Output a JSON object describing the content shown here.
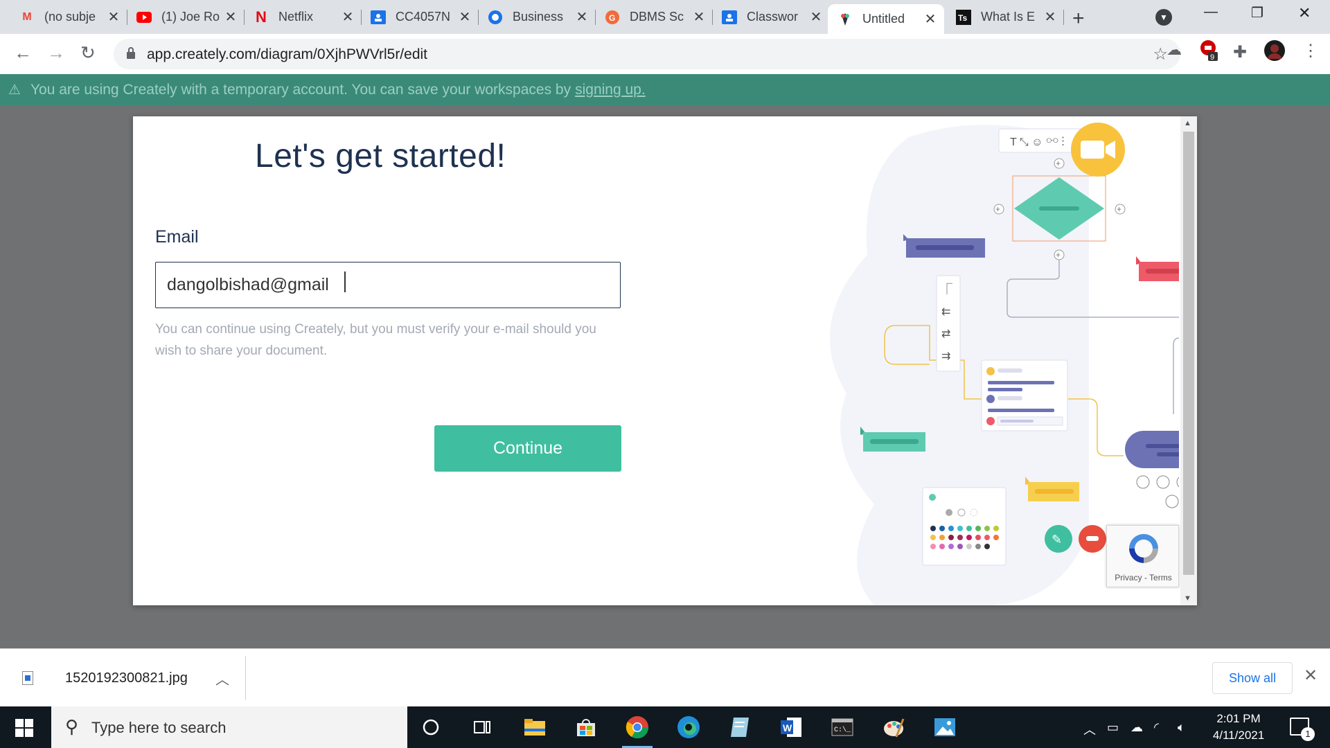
{
  "browser": {
    "tabs": [
      {
        "title": "(no subje",
        "icon": "gmail-icon",
        "active": false
      },
      {
        "title": "(1) Joe Ro",
        "icon": "youtube-icon",
        "active": false
      },
      {
        "title": "Netflix",
        "icon": "netflix-icon",
        "active": false
      },
      {
        "title": "CC4057N",
        "icon": "classroom-icon",
        "active": false
      },
      {
        "title": "Business",
        "icon": "teams-icon",
        "active": false
      },
      {
        "title": "DBMS Sc",
        "icon": "app-icon",
        "active": false
      },
      {
        "title": "Classwor",
        "icon": "classroom-icon",
        "active": false
      },
      {
        "title": "Untitled",
        "icon": "creately-icon",
        "active": true
      },
      {
        "title": "What Is E",
        "icon": "ts-icon",
        "active": false
      }
    ],
    "new_tab_label": "+",
    "url": "app.creately.com/diagram/0XjhPWVrl5r/edit",
    "extension_badge": "9"
  },
  "banner": {
    "text": "You are using Creately with a temporary account. You can save your workspaces by",
    "link": "signing up."
  },
  "modal": {
    "title": "Let's get started!",
    "email_label": "Email",
    "email_value": "dangolbishad@gmail",
    "helper_text": "You can continue using Creately, but you must verify your e-mail should you wish to share your document.",
    "continue_label": "Continue",
    "recaptcha_text": "Privacy - Terms"
  },
  "downloads": {
    "file_name": "1520192300821.jpg",
    "show_all_label": "Show all"
  },
  "taskbar": {
    "search_placeholder": "Type here to search",
    "time": "2:01 PM",
    "date": "4/11/2021",
    "notification_count": "1"
  },
  "colors": {
    "accent": "#3fbf9f",
    "banner": "#3a8a77",
    "title": "#1e3150"
  }
}
